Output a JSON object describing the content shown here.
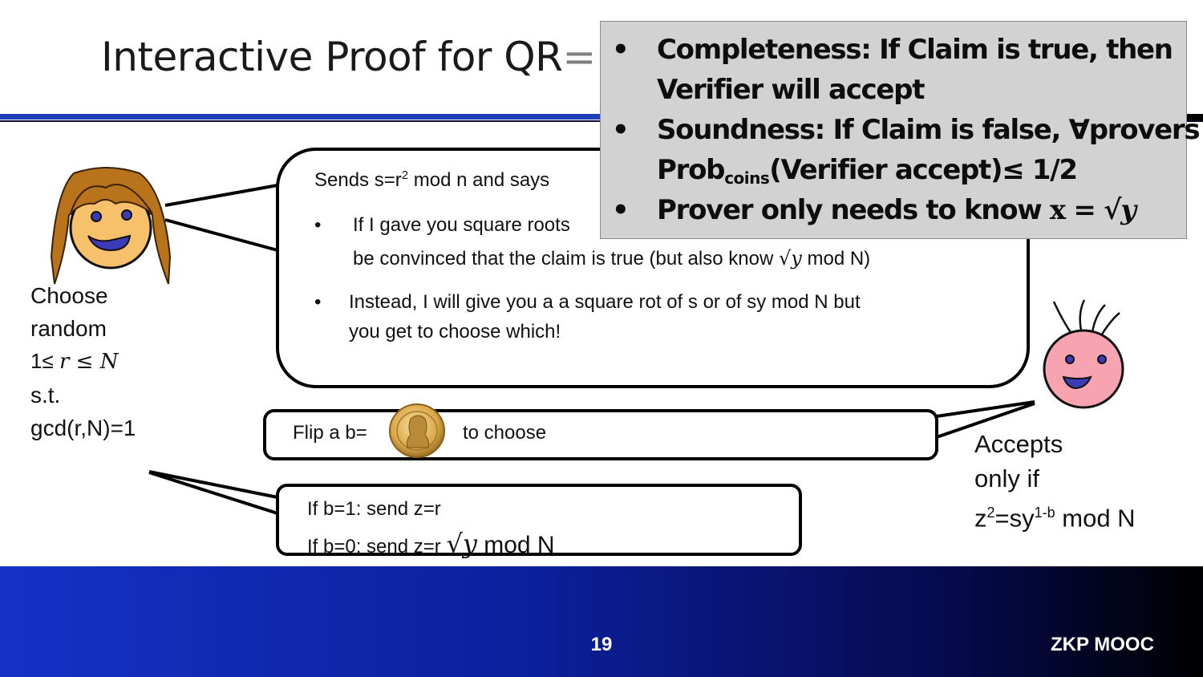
{
  "slide": {
    "title": "Interactive Proof for QR",
    "title_tail": "= {",
    "page_number": "19",
    "brand": "ZKP MOOC"
  },
  "overlay": {
    "bullet": "•",
    "completeness_1": "Completeness: If Claim is true, then",
    "completeness_2": "Verifier will accept",
    "soundness_1": "Soundness: If Claim is false, ∀provers",
    "soundness_2a": "Prob",
    "soundness_sub": "coins",
    "soundness_2b": "(Verifier accept)≤ 1/2",
    "prover_text": "Prover only needs to know ",
    "prover_x": "x",
    "prover_eq": " = ",
    "prover_sqrt": "√",
    "prover_y": "y"
  },
  "prover": {
    "choose_1": "Choose",
    "choose_2": "random",
    "range_a": "1≤ ",
    "range_r": "r",
    "range_b": " ≤ ",
    "range_n": "N",
    "st": "s.t.",
    "gcd": "gcd(r,N)=1"
  },
  "main_bubble": {
    "sends_a": "Sends s=r",
    "sends_sup": "2",
    "sends_b": " mod n and says",
    "bullet": "•",
    "b1_line1": "If I gave you square roots",
    "b1_line2a": "be convinced that the claim is true (but also know ",
    "b1_sqrt": "√",
    "b1_y": "y",
    "b1_line2b": " mod N)",
    "b2_line1": "Instead, I will give you a  a square rot of s or of sy mod N but",
    "b2_line2": "you get to choose which!"
  },
  "flip_bubble": {
    "left": "Flip a  b=",
    "right": "to choose"
  },
  "send_bubble": {
    "line1": "If b=1: send z=r",
    "line2a": "If b=0: send z=r ",
    "line2_sqrt": "√",
    "line2_y": "y",
    "line2b": " mod N"
  },
  "verifier": {
    "accepts": "Accepts",
    "only_if": "only  if",
    "eq_a": "z",
    "eq_sup1": "2",
    "eq_b": "=sy",
    "eq_sup2": "1-b",
    "eq_c": " mod N"
  },
  "colors": {
    "header_rule": "#1f3fb8",
    "overlay_bg": "#d2d2d2",
    "footer_start": "#1432c6",
    "footer_end": "#000000",
    "prover_hair": "#b8731b",
    "prover_face": "#f7c06a",
    "verifier_face": "#f7a3b0",
    "mouth": "#3b3bb8"
  },
  "icons": {
    "prover": "girl-face-icon",
    "verifier": "alien-face-icon",
    "coin": "coin-icon"
  }
}
